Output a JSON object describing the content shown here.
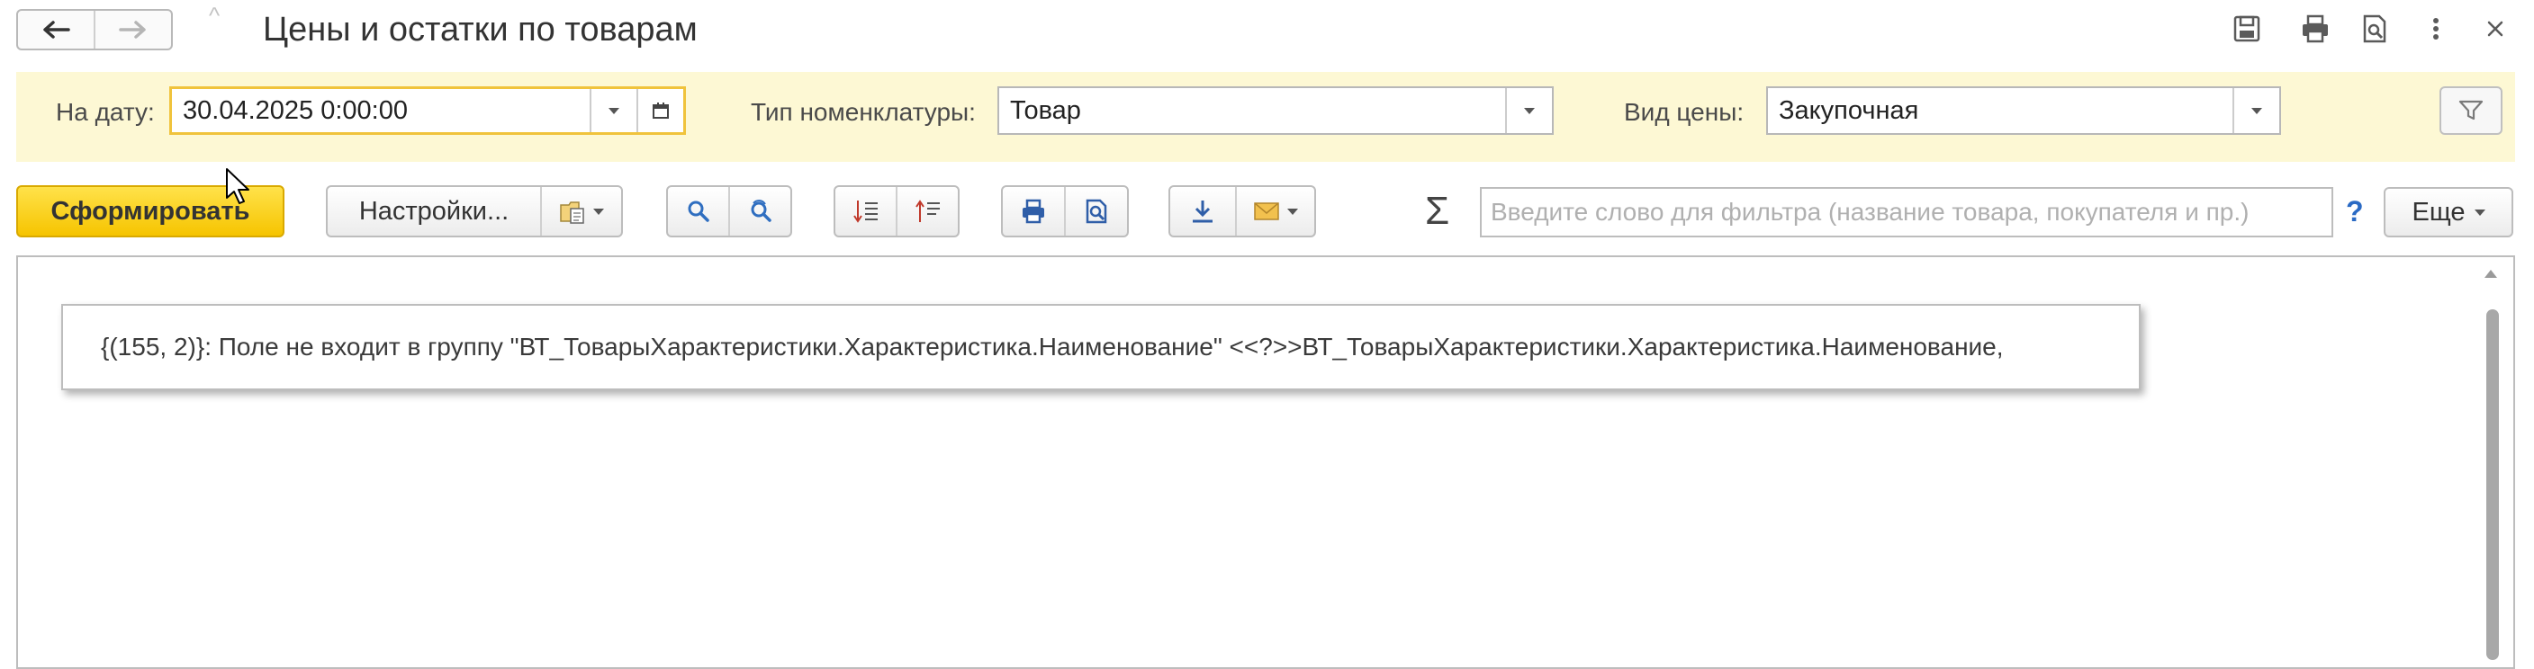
{
  "window": {
    "title": "Цены и остатки по товарам",
    "nav": {
      "back_icon": "arrow-left-icon",
      "forward_icon": "arrow-right-icon"
    },
    "icons": [
      "save-icon",
      "print-icon",
      "preview-icon",
      "more-vertical-icon",
      "close-icon"
    ]
  },
  "params": {
    "date_label": "На дату:",
    "date_value": "30.04.2025  0:00:00",
    "nomenclature_type_label": "Тип номенклатуры:",
    "nomenclature_type_value": "Товар",
    "price_type_label": "Вид цены:",
    "price_type_value": "Закупочная"
  },
  "toolbar": {
    "generate_label": "Сформировать",
    "settings_label": "Настройки...",
    "search_placeholder": "Введите слово для фильтра (название товара, покупателя и пр.)",
    "search_value": "",
    "help_label": "?",
    "more_label": "Еще"
  },
  "report": {
    "error_text": "{(155, 2)}: Поле не входит в группу \"ВТ_ТоварыХарактеристики.Характеристика.Наименование\" <<?>>ВТ_ТоварыХарактеристики.Характеристика.Наименование,"
  },
  "colors": {
    "accent_yellow": "#f6c400",
    "param_panel_bg": "#fdf8d4",
    "date_focus_border": "#f0c33c",
    "help_blue": "#2a6ac4"
  }
}
